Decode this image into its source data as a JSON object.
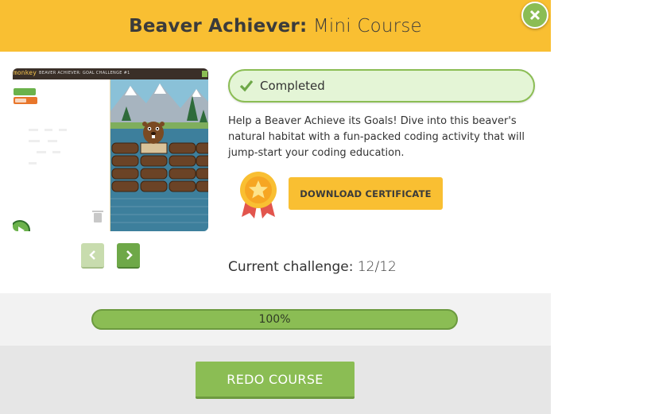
{
  "header": {
    "title_bold": "Beaver Achiever:",
    "title_light": " Mini Course"
  },
  "icons": {
    "close": "close-icon",
    "check": "check-icon",
    "medal": "medal-icon",
    "prev": "chevron-left-icon",
    "next": "chevron-right-icon",
    "play": "play-icon"
  },
  "preview": {
    "logo": "monkey",
    "title": "BEAVER ACHIEVER: GOAL CHALLENGE #1",
    "block_label": "on play"
  },
  "status": {
    "label": "Completed"
  },
  "description": "Help a Beaver Achieve its Goals! Dive into this beaver's natural habitat with a fun-packed coding activity that will jump-start your coding education.",
  "certificate": {
    "button_label": "DOWNLOAD CERTIFICATE"
  },
  "challenge": {
    "label": "Current challenge:",
    "value": "12/12"
  },
  "progress": {
    "label": "100%",
    "value": 1.0
  },
  "footer": {
    "redo_label": "REDO COURSE"
  },
  "colors": {
    "header_bg": "#f9bf32",
    "accent_green": "#8bbd54",
    "status_bg": "#e4f5d6"
  }
}
